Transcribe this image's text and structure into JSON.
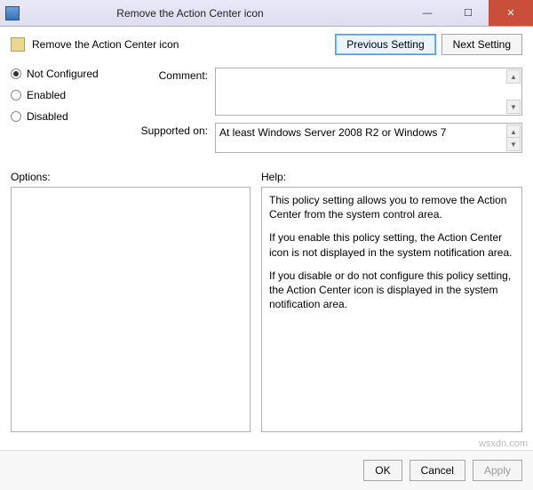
{
  "window": {
    "title": "Remove the Action Center icon"
  },
  "header": {
    "policy_name": "Remove the Action Center icon",
    "prev_btn": "Previous Setting",
    "next_btn": "Next Setting"
  },
  "radios": {
    "not_configured": "Not Configured",
    "enabled": "Enabled",
    "disabled": "Disabled",
    "selected": "not_configured"
  },
  "form": {
    "comment_label": "Comment:",
    "comment_value": "",
    "supported_label": "Supported on:",
    "supported_value": "At least Windows Server 2008 R2 or Windows 7"
  },
  "panels": {
    "options_label": "Options:",
    "help_label": "Help:",
    "help_p1": "This policy setting allows you to remove the Action Center from the system control area.",
    "help_p2": "If you enable this policy setting, the Action Center icon is not displayed in the system notification area.",
    "help_p3": "If you disable or do not configure this policy setting, the Action Center icon is displayed in the system notification area."
  },
  "footer": {
    "ok": "OK",
    "cancel": "Cancel",
    "apply": "Apply"
  },
  "watermark": "wsxdn.com"
}
